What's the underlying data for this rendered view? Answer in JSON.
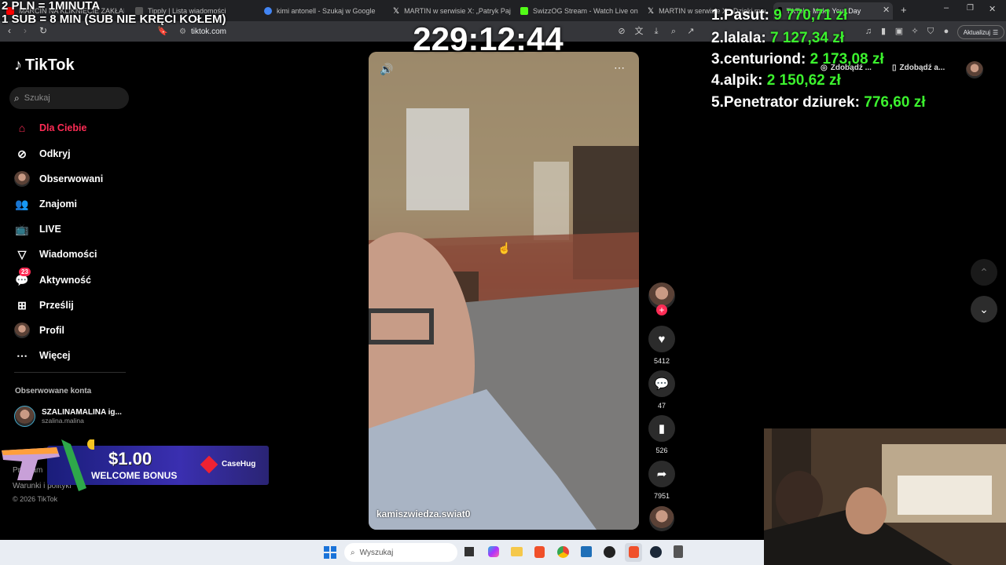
{
  "overlay": {
    "line1": "2 PLN = 1MINUTA",
    "line2": "1 SUB = 8 MIN (SUB NIE KRĘCI KOŁEM)",
    "timer": "229:12:44",
    "leaderboard": [
      {
        "rank": "1.",
        "name": "Pasut:",
        "amount": "9 770,71 zł"
      },
      {
        "rank": "2.",
        "name": "lalala:",
        "amount": "7 127,34 zł"
      },
      {
        "rank": "3.",
        "name": "centuriond:",
        "amount": "2 173,08 zł"
      },
      {
        "rank": "4.",
        "name": "alpik:",
        "amount": "2 150,62 zł"
      },
      {
        "rank": "5.",
        "name": "Penetrator dziurek:",
        "amount": "776,60 zł"
      }
    ]
  },
  "browser": {
    "tabs": [
      {
        "label": "MARCIN NA KLIKNIĘCIE ZAKŁADA",
        "color": "#ff0000"
      },
      {
        "label": "Tipply | Lista wiadomości",
        "color": "#3d3d3d"
      },
      {
        "label": "kimi antonell - Szukaj w Google",
        "color": "#4285f4"
      },
      {
        "label": "MARTIN w serwisie X: „Patryk Pajako",
        "color": "#000000"
      },
      {
        "label": "SwizzOG Stream - Watch Live on Kick",
        "color": "#53fc18"
      },
      {
        "label": "MARTIN w serwisie X: „Dzięki mocy S",
        "color": "#000000"
      },
      {
        "label": "TikTok - Make Your Day",
        "color": "#000000"
      }
    ],
    "url": "tiktok.com",
    "update_label": "Aktualizuj",
    "tiktok_promo_1": "Zdobądź ...",
    "tiktok_promo_2": "Zdobądź a..."
  },
  "sidebar": {
    "logo": "TikTok",
    "search_placeholder": "Szukaj",
    "items": [
      {
        "label": "Dla Ciebie",
        "icon": "home-icon"
      },
      {
        "label": "Odkryj",
        "icon": "compass-icon"
      },
      {
        "label": "Obserwowani",
        "icon": "avatar-icon"
      },
      {
        "label": "Znajomi",
        "icon": "friends-icon"
      },
      {
        "label": "LIVE",
        "icon": "live-icon"
      },
      {
        "label": "Wiadomości",
        "icon": "messages-icon"
      },
      {
        "label": "Aktywność",
        "icon": "activity-icon",
        "badge": "23"
      },
      {
        "label": "Prześlij",
        "icon": "upload-icon"
      },
      {
        "label": "Profil",
        "icon": "profile-icon"
      },
      {
        "label": "Więcej",
        "icon": "more-icon"
      }
    ],
    "followed_header": "Obserwowane konta",
    "followed": [
      {
        "name": "SZALINAMALINA ig...",
        "handle": "szalina.malina"
      }
    ],
    "footer": {
      "program": "Program",
      "terms": "Warunki i polityki",
      "copyright": "© 2026 TikTok"
    }
  },
  "bonus_banner": {
    "amount": "$1.00",
    "text": "WELCOME BONUS",
    "brand": "CaseHug"
  },
  "video": {
    "username": "kamiszwiedza.swiat0"
  },
  "actions": {
    "likes": "5412",
    "comments": "47",
    "saves": "526",
    "shares": "7951"
  },
  "taskbar": {
    "search_placeholder": "Wyszukaj"
  }
}
